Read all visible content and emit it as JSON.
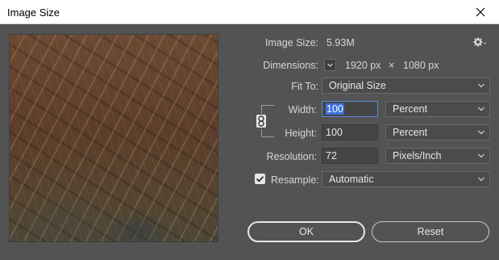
{
  "window": {
    "title": "Image Size"
  },
  "info": {
    "image_size_label": "Image Size:",
    "image_size_value": "5.93M",
    "dimensions_label": "Dimensions:",
    "dimensions_width": "1920 px",
    "dimensions_times": "×",
    "dimensions_height": "1080 px"
  },
  "fit_to": {
    "label": "Fit To:",
    "value": "Original Size"
  },
  "width": {
    "label": "Width:",
    "value": "100",
    "unit": "Percent"
  },
  "height": {
    "label": "Height:",
    "value": "100",
    "unit": "Percent"
  },
  "resolution": {
    "label": "Resolution:",
    "value": "72",
    "unit": "Pixels/Inch"
  },
  "resample": {
    "label": "Resample:",
    "checked": true,
    "value": "Automatic"
  },
  "buttons": {
    "ok": "OK",
    "reset": "Reset"
  },
  "icons": {
    "close": "close-icon",
    "settings": "gear-icon",
    "link": "chain-link-icon",
    "dropdown": "chevron-down-icon"
  },
  "colors": {
    "background": "#535353",
    "title_bar": "#ffffff",
    "selection": "#3a6fd8"
  }
}
